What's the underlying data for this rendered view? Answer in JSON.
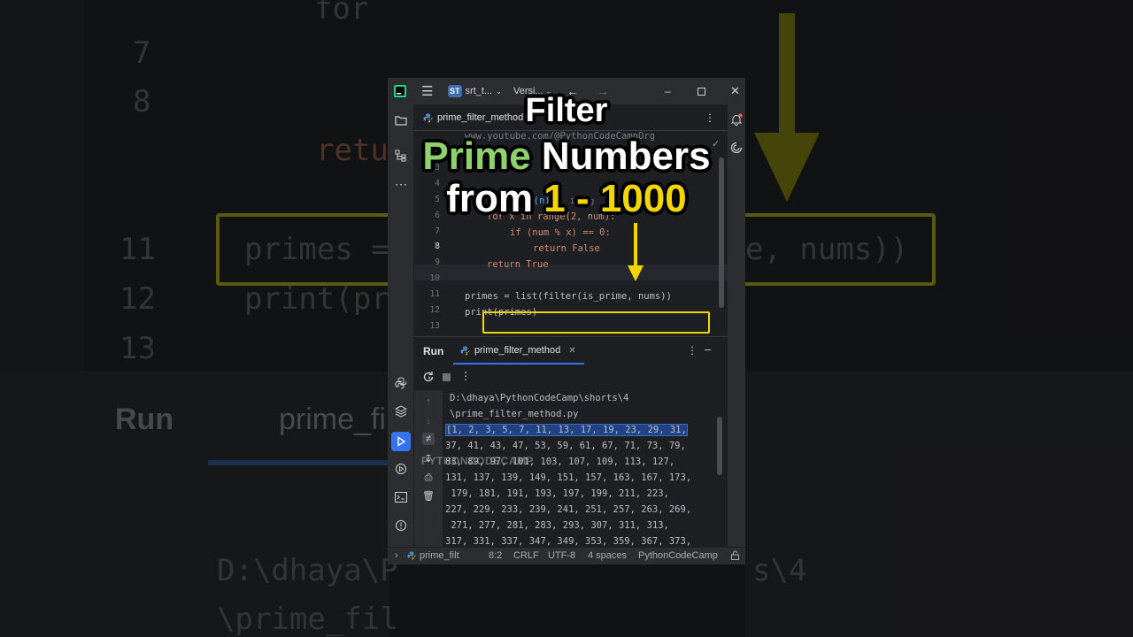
{
  "window": {
    "project_badge": "ST",
    "project_name": "srt_t...",
    "vcs_label": "Versi...",
    "notification_icon": "bell-icon"
  },
  "editor": {
    "tab_label": "prime_filter_method.py",
    "line_numbers": [
      "3",
      "4",
      "5",
      "6",
      "7",
      "8",
      "9",
      "10",
      "11",
      "12",
      "13"
    ],
    "current_line": "8",
    "visible_comment": "www.youtube.com/@PythonCodeCampOrg",
    "lines": {
      "l6": "for x in range(2, num):",
      "l7": "if (num % x) == 0:",
      "l8": "return False",
      "l9": "return True",
      "l11": "primes = list(filter(is_prime, nums))",
      "l12": "print(primes)"
    },
    "fragment_5": "me(n):",
    "usage_hint": "1 usag"
  },
  "run_panel": {
    "label": "Run",
    "tab_label": "prime_filter_method",
    "output": [
      "D:\\dhaya\\PythonCodeCamp\\shorts\\4",
      "\\prime_filter_method.py",
      "[1, 2, 3, 5, 7, 11, 13, 17, 19, 23, 29, 31,",
      "37, 41, 43, 47, 53, 59, 61, 67, 71, 73, 79,",
      "83, 89, 97, 101, 103, 107, 109, 113, 127,",
      "131, 137, 139, 149, 151, 157, 163, 167, 173,",
      " 179, 181, 191, 193, 197, 199, 211, 223,",
      "227, 229, 233, 239, 241, 251, 257, 263, 269,",
      " 271, 277, 281, 283, 293, 307, 311, 313,",
      "317, 331, 337, 347, 349, 353, 359, 367, 373,"
    ],
    "watermark": "PYTHONCODECAMP"
  },
  "status_bar": {
    "file": "prime_filt",
    "position": "8:2",
    "line_sep": "CRLF",
    "encoding": "UTF-8",
    "indent": "4 spaces",
    "interpreter": "PythonCodeCamp"
  },
  "overlay": {
    "line1": "Filter",
    "line2_green": "Prime",
    "line2_white": "Numbers",
    "line3_white": "from",
    "line3_yellow": "1 - 1000"
  },
  "background_echo": {
    "run": "Run",
    "tab": "prime_fi",
    "code_11": "primes = ",
    "code_11_right": "e, nums))",
    "code_12": "print(pr",
    "ret": "retu",
    "for": "for",
    "path1": "D:\\dhaya\\P",
    "path1_right": "s\\4",
    "path2": "\\prime_fil",
    "nums": [
      "7",
      "8",
      "11",
      "12",
      "13"
    ]
  },
  "colors": {
    "accent_yellow": "#f2d600",
    "title_green": "#8fd16a",
    "selection": "#214283",
    "ide_bg": "#1e1f22"
  }
}
